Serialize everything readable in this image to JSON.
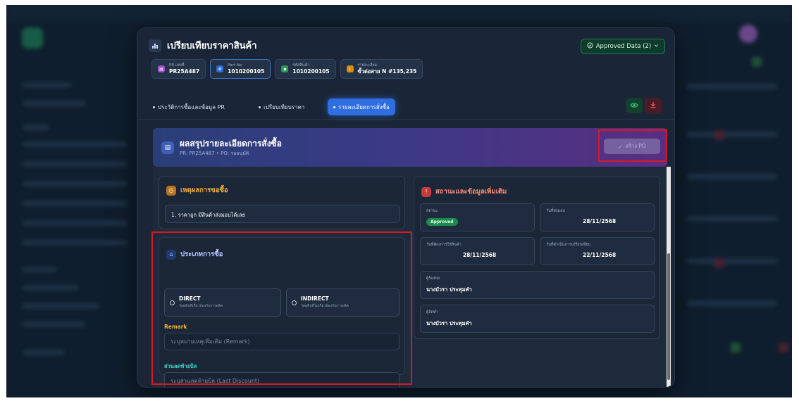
{
  "header": {
    "title": "เปรียบเทียบราคาสินค้า",
    "approved_label": "Approved Data (2)"
  },
  "chips": [
    {
      "label": "PR เลขที่",
      "value": "PR25A487",
      "color": "#a04bd6"
    },
    {
      "label": "Part No",
      "value": "1010200105",
      "color": "#2f6ee0"
    },
    {
      "label": "รหัสสินค้า",
      "value": "1010200105",
      "color": "#2f9a5a"
    },
    {
      "label": "รายละเอียด",
      "value": "ขั้วต่อสาย N #135,235",
      "color": "#d98a1a"
    }
  ],
  "tabs": [
    {
      "label": "ประวัติการซื้อและข้อมูล PR"
    },
    {
      "label": "เปรียบเทียบราคา"
    },
    {
      "label": "รายละเอียดการสั่งซื้อ"
    }
  ],
  "summary": {
    "title": "ผลสรุปรายละเอียดการสั่งซื้อ",
    "subtitle": "PR: PR25A487 • PO: รออนุมัติ",
    "create_po_label": "สร้าง PO"
  },
  "reason": {
    "title": "เหตุผลการขอซื้อ",
    "text": "1. ราคาถูก มีสินค้าส่งมอบได้เลย"
  },
  "purchase_type": {
    "title": "ประเภทการซื้อ",
    "options": [
      {
        "title": "DIRECT",
        "desc": "วัสดุดิบที่เกี่ยวข้องกับการผลิต"
      },
      {
        "title": "INDIRECT",
        "desc": "วัสดุดิบที่ไม่เกี่ยวข้องกับการผลิต"
      }
    ],
    "remark_label": "Remark",
    "remark_placeholder": "ระบุหมายเหตุเพิ่มเติม (Remark)",
    "discount_label": "ส่วนลดท้ายบิล",
    "discount_placeholder": "ระบุส่วนลดท้ายบิล (Last Discount)"
  },
  "status": {
    "title": "สถานะและข้อมูลเพิ่มเติม",
    "status_label": "สถานะ",
    "status_value": "Approved",
    "delivery_label": "วันที่ส่งมอบ",
    "delivery_value": "28/11/2568",
    "need_date_label": "วันที่ต้องการใช้สินค้า",
    "need_date_value": "28/11/2568",
    "compare_date_label": "วันที่ดำเนินการเปรียบเทียบ",
    "compare_date_value": "22/11/2568",
    "requester_label": "ผู้ร้องขอ",
    "requester_value": "นางบัวรา ประทุมคำ",
    "buyer_label": "ผู้จัดทำ",
    "buyer_value": "นางบัวรา ประทุมคำ"
  }
}
